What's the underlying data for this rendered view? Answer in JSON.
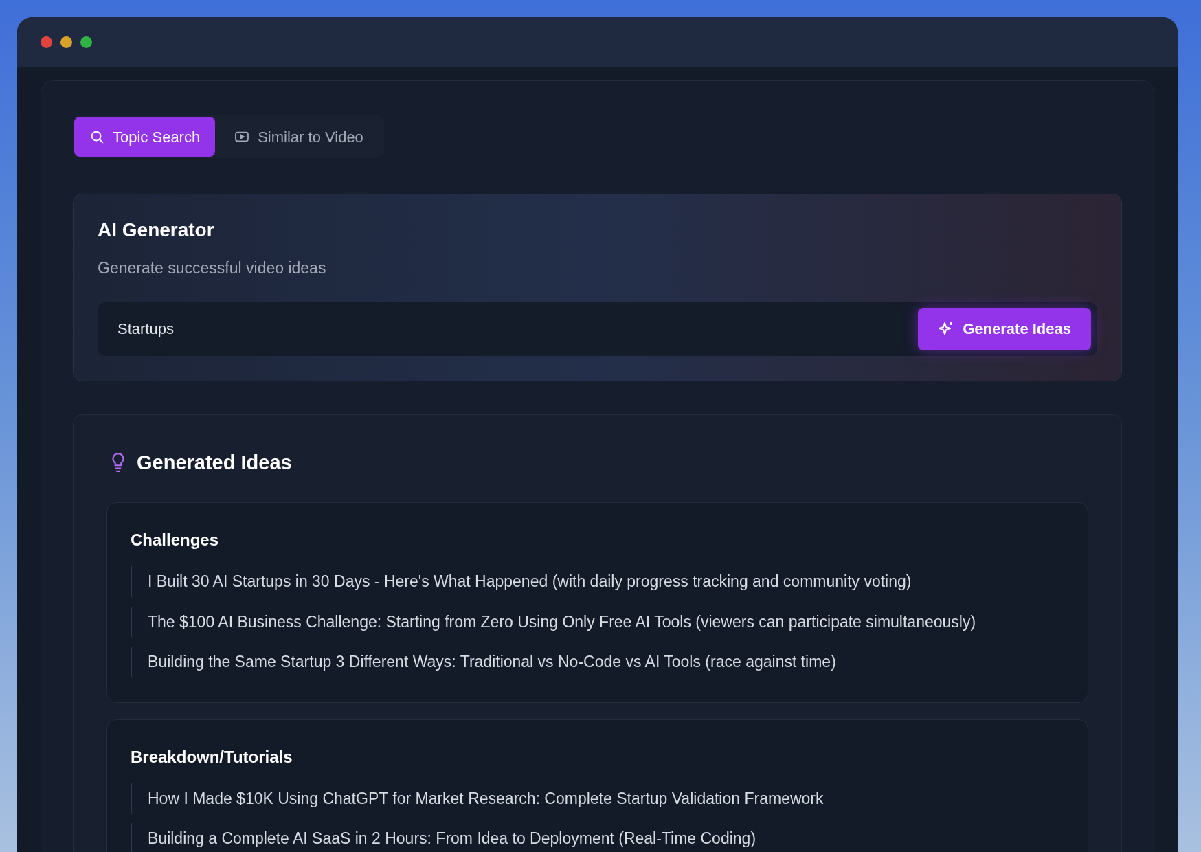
{
  "tabs": [
    {
      "label": "Topic Search",
      "kind": "search",
      "selected": true
    },
    {
      "label": "Similar to Video",
      "kind": "video",
      "selected": false
    }
  ],
  "generator": {
    "title": "AI Generator",
    "subtitle": "Generate successful video ideas",
    "input_value": "Startups",
    "button": "Generate Ideas"
  },
  "results": {
    "title": "Generated Ideas",
    "categories": [
      {
        "name": "Challenges",
        "ideas": [
          "I Built 30 AI Startups in 30 Days - Here's What Happened (with daily progress tracking and community voting)",
          "The $100 AI Business Challenge: Starting from Zero Using Only Free AI Tools (viewers can participate simultaneously)",
          "Building the Same Startup 3 Different Ways: Traditional vs No-Code vs AI Tools (race against time)"
        ]
      },
      {
        "name": "Breakdown/Tutorials",
        "ideas": [
          "How I Made $10K Using ChatGPT for Market Research: Complete Startup Validation Framework",
          "Building a Complete AI SaaS in 2 Hours: From Idea to Deployment (Real-Time Coding)"
        ]
      }
    ]
  }
}
